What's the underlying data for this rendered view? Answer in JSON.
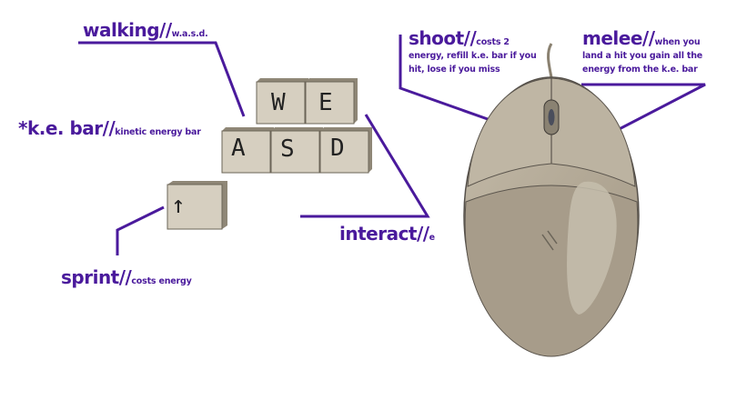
{
  "labels": {
    "walking": {
      "title": "walking//",
      "detail": "w.a.s.d."
    },
    "ke_bar": {
      "title": "*k.e. bar//",
      "detail": "kinetic energy bar"
    },
    "sprint": {
      "title": "sprint//",
      "detail": "costs energy"
    },
    "interact": {
      "title": "interact//",
      "detail": "e"
    },
    "shoot": {
      "title": "shoot//",
      "detail": "costs 2 energy, refill k.e. bar if you hit, lose if you miss"
    },
    "melee": {
      "title": "melee//",
      "detail": "when you land a hit you gain all the energy from the k.e. bar"
    }
  },
  "keys": {
    "w": "W",
    "e": "E",
    "a": "A",
    "s": "S",
    "d": "D",
    "shift": "↑"
  },
  "colors": {
    "accent": "#4a1a9c",
    "key_face": "#d6cfc0",
    "key_side": "#8f8777",
    "mouse_body": "#b7ad9c",
    "mouse_dark": "#a29886"
  },
  "icons": {
    "mouse": "computer-mouse-icon",
    "scroll_wheel": "scroll-wheel-icon"
  }
}
